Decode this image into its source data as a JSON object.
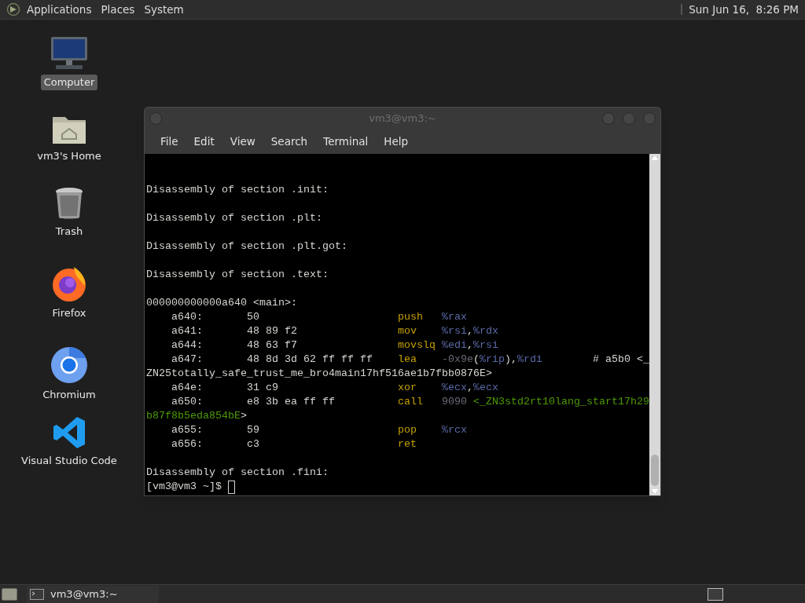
{
  "top_panel": {
    "menus": [
      "Applications",
      "Places",
      "System"
    ],
    "clock": "Sun Jun 16,  8:26 PM"
  },
  "desktop_icons": [
    {
      "label": "Computer",
      "kind": "computer",
      "selected": true
    },
    {
      "label": "vm3's Home",
      "kind": "home",
      "selected": false
    },
    {
      "label": "Trash",
      "kind": "trash",
      "selected": false
    },
    {
      "label": "Firefox",
      "kind": "firefox",
      "selected": false
    },
    {
      "label": "Chromium",
      "kind": "chromium",
      "selected": false
    },
    {
      "label": "Visual Studio Code",
      "kind": "vscode",
      "selected": false
    }
  ],
  "window": {
    "title": "vm3@vm3:~",
    "menu": [
      "File",
      "Edit",
      "View",
      "Search",
      "Terminal",
      "Help"
    ],
    "lines": [
      {
        "kind": "blank"
      },
      {
        "kind": "blank"
      },
      {
        "kind": "text",
        "text": "Disassembly of section .init:"
      },
      {
        "kind": "blank"
      },
      {
        "kind": "text",
        "text": "Disassembly of section .plt:"
      },
      {
        "kind": "blank"
      },
      {
        "kind": "text",
        "text": "Disassembly of section .plt.got:"
      },
      {
        "kind": "blank"
      },
      {
        "kind": "text",
        "text": "Disassembly of section .text:"
      },
      {
        "kind": "blank"
      },
      {
        "kind": "text",
        "text": "000000000000a640 <main>:"
      },
      {
        "kind": "instruction",
        "address": "a640:",
        "bytes": "50",
        "mnemonic": "push",
        "operands": [
          {
            "kind": "register",
            "text": "%rax"
          }
        ]
      },
      {
        "kind": "instruction",
        "address": "a641:",
        "bytes": "48 89 f2",
        "mnemonic": "mov",
        "operands": [
          {
            "kind": "register",
            "text": "%rsi"
          },
          {
            "kind": "plain",
            "text": ","
          },
          {
            "kind": "register",
            "text": "%rdx"
          }
        ]
      },
      {
        "kind": "instruction",
        "address": "a644:",
        "bytes": "48 63 f7",
        "mnemonic": "movslq",
        "operands": [
          {
            "kind": "register",
            "text": "%edi"
          },
          {
            "kind": "plain",
            "text": ","
          },
          {
            "kind": "register",
            "text": "%rsi"
          }
        ]
      },
      {
        "kind": "instruction",
        "address": "a647:",
        "bytes": "48 8d 3d 62 ff ff ff",
        "mnemonic": "lea",
        "operands": [
          {
            "kind": "number",
            "text": "-0x9e"
          },
          {
            "kind": "plain",
            "text": "("
          },
          {
            "kind": "register",
            "text": "%rip"
          },
          {
            "kind": "plain",
            "text": "),"
          },
          {
            "kind": "register",
            "text": "%rdi"
          }
        ],
        "comment": "# a5b0 <_"
      },
      {
        "kind": "continuation",
        "segments": [
          {
            "kind": "plain",
            "text": "ZN25totally_safe_trust_me_bro4main17hf516ae1b7fbb0876E>"
          }
        ]
      },
      {
        "kind": "instruction",
        "address": "a64e:",
        "bytes": "31 c9",
        "mnemonic": "xor",
        "operands": [
          {
            "kind": "register",
            "text": "%ecx"
          },
          {
            "kind": "plain",
            "text": ","
          },
          {
            "kind": "register",
            "text": "%ecx"
          }
        ]
      },
      {
        "kind": "instruction",
        "address": "a650:",
        "bytes": "e8 3b ea ff ff",
        "mnemonic": "call",
        "operands": [
          {
            "kind": "number",
            "text": "9090"
          },
          {
            "kind": "symbol",
            "text": "<_ZN3std2rt10lang_start17h29"
          }
        ]
      },
      {
        "kind": "continuation",
        "segments": [
          {
            "kind": "symbol",
            "text": "b87f8b5eda854bE"
          },
          {
            "kind": "plain",
            "text": ">"
          }
        ]
      },
      {
        "kind": "instruction",
        "address": "a655:",
        "bytes": "59",
        "mnemonic": "pop",
        "operands": [
          {
            "kind": "register",
            "text": "%rcx"
          }
        ]
      },
      {
        "kind": "instruction",
        "address": "a656:",
        "bytes": "c3",
        "mnemonic": "ret"
      },
      {
        "kind": "blank"
      },
      {
        "kind": "text",
        "text": "Disassembly of section .fini:"
      },
      {
        "kind": "prompt",
        "text": "[vm3@vm3 ~]$"
      }
    ]
  },
  "bottom_panel": {
    "tasks": [
      {
        "label": "vm3@vm3:~",
        "selected": false
      }
    ]
  }
}
